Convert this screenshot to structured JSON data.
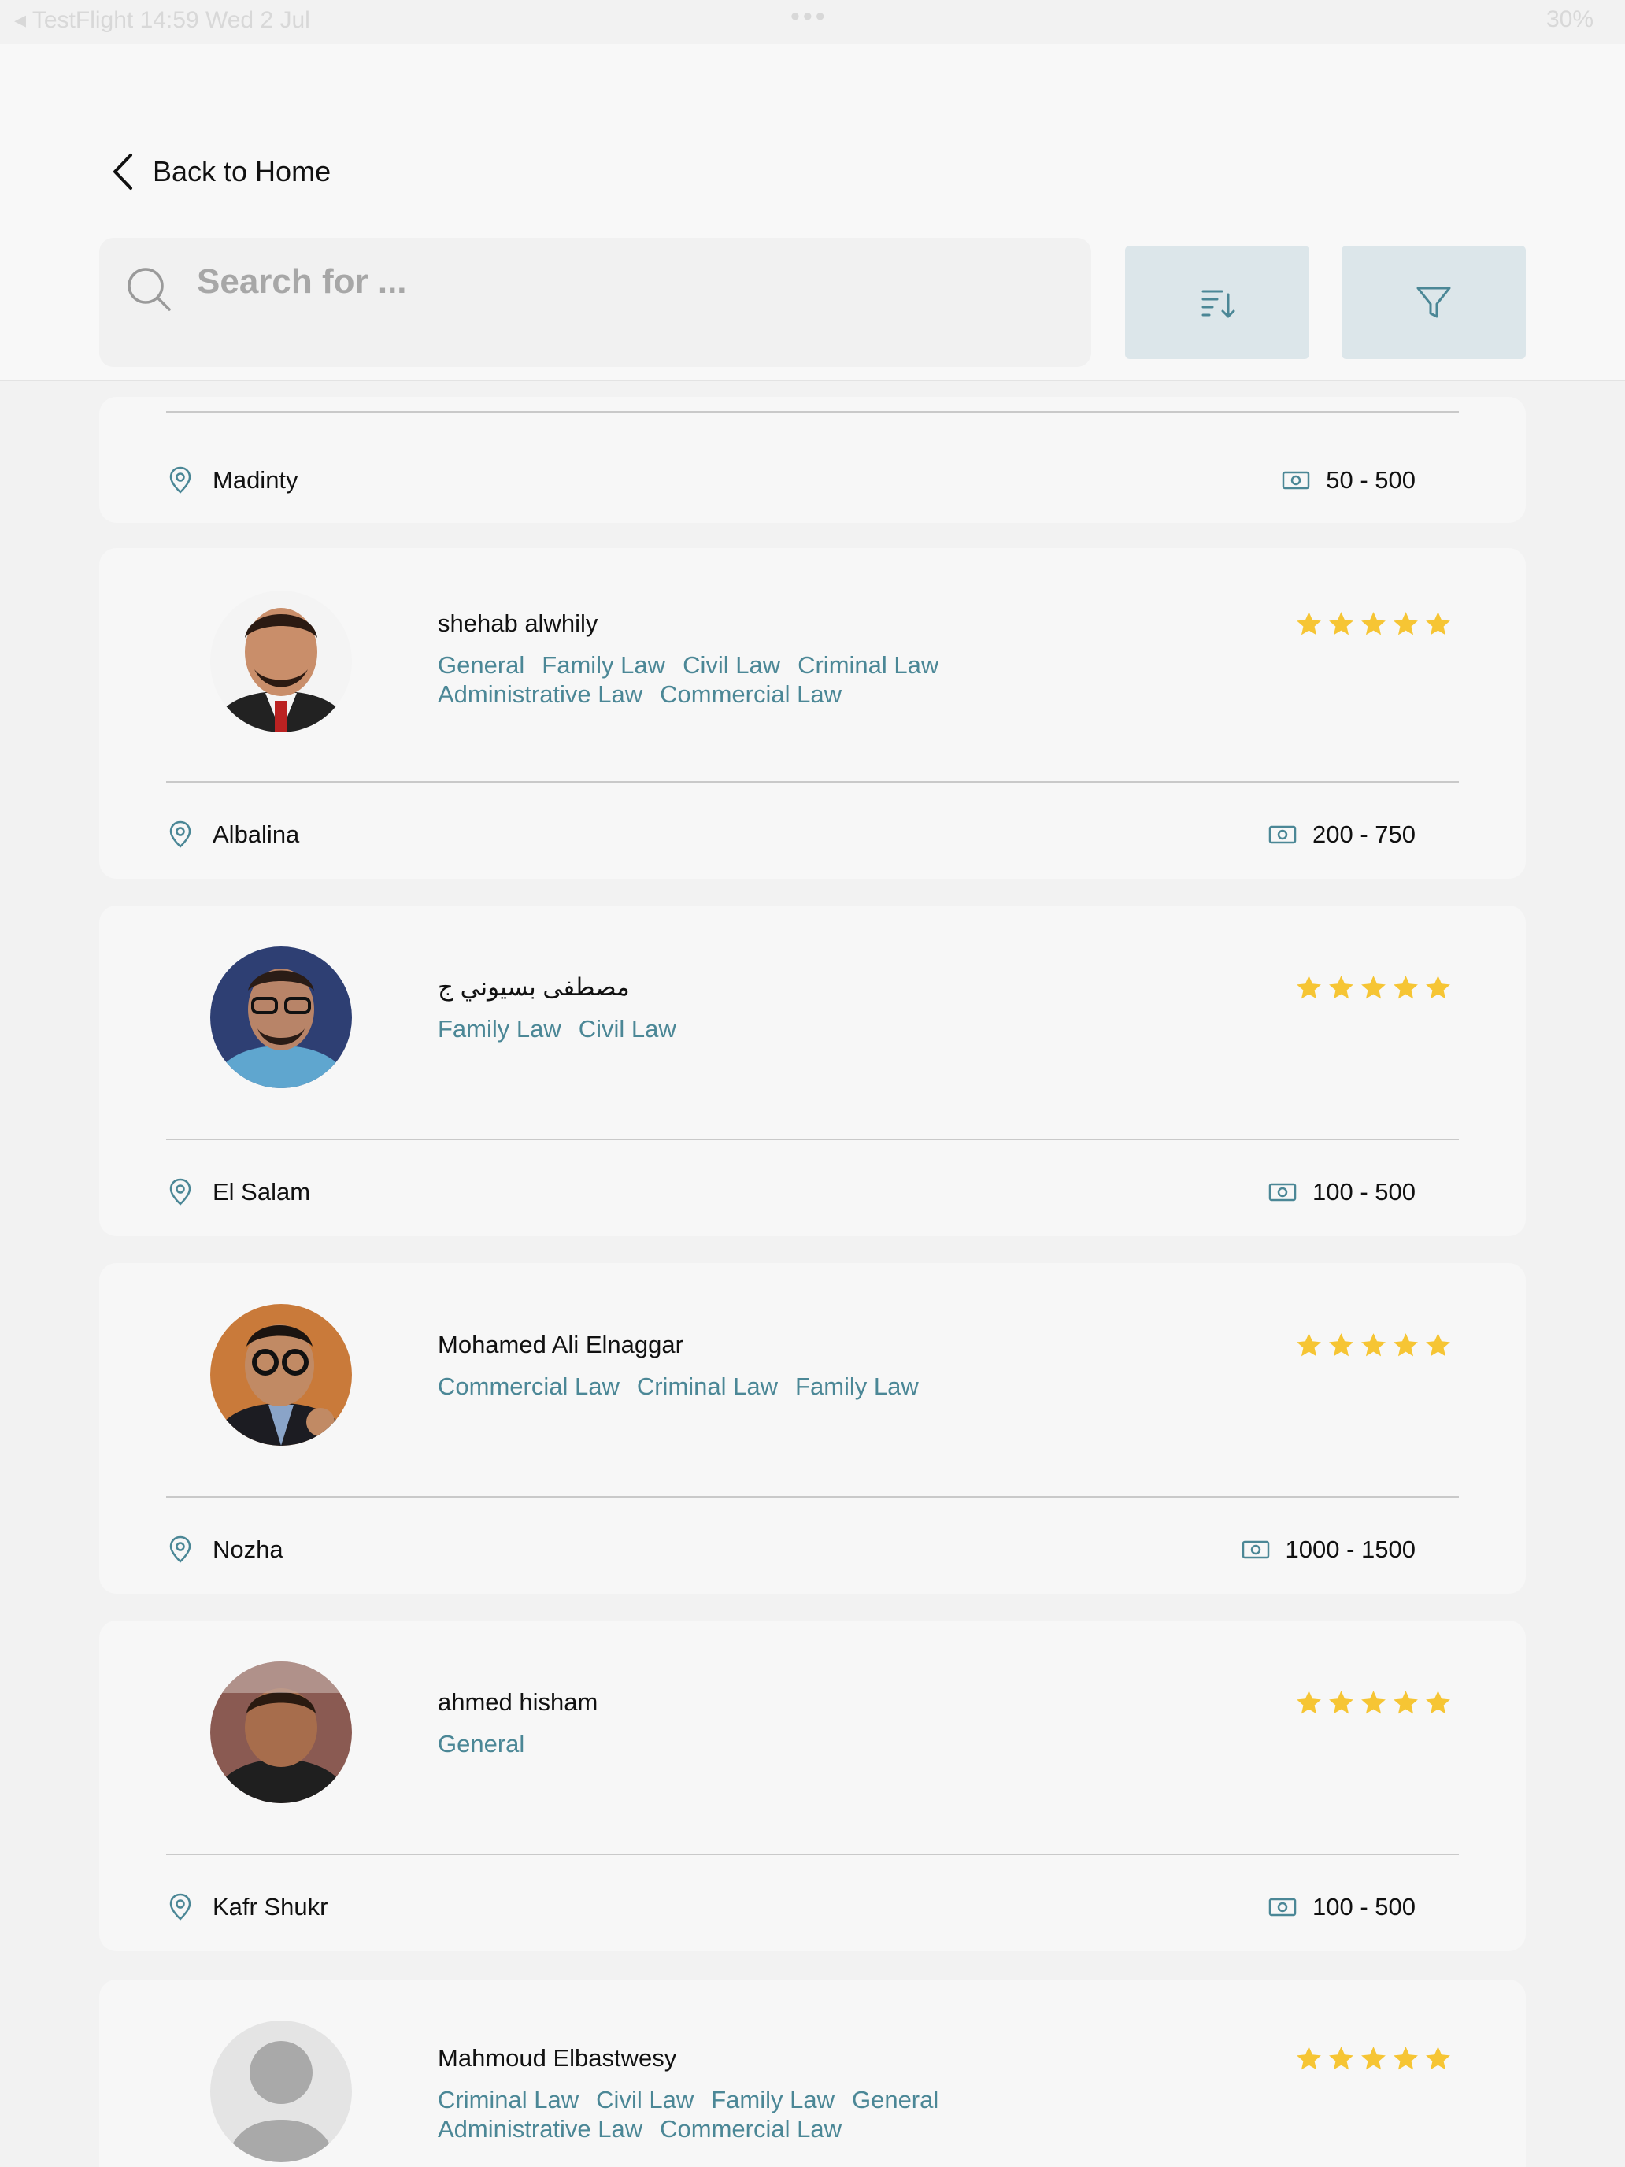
{
  "status_bar": {
    "left": "◂ TestFlight  14:59  Wed 2 Jul",
    "dots": "•••",
    "right": "30%"
  },
  "header": {
    "back_label": "Back to Home",
    "search_placeholder": "Search for ...",
    "sort_icon": "sort-icon",
    "filter_icon": "filter-icon"
  },
  "colors": {
    "accent": "#4b8796",
    "star": "#f6c534",
    "button_bg": "#dce6ea"
  },
  "partial_card": {
    "location": "Madinty",
    "fee": "50 - 500"
  },
  "lawyers": [
    {
      "name": "shehab  alwhily",
      "tags": [
        "General",
        "Family Law",
        "Civil Law",
        "Criminal Law",
        "Administrative Law",
        "Commercial Law"
      ],
      "rating": 5,
      "location": "Albalina",
      "fee": "200 - 750"
    },
    {
      "name": "مصطفى بسيوني ج",
      "tags": [
        "Family Law",
        "Civil Law"
      ],
      "rating": 5,
      "location": "El Salam",
      "fee": "100 - 500"
    },
    {
      "name": "Mohamed Ali Elnaggar",
      "tags": [
        "Commercial Law",
        "Criminal Law",
        "Family Law"
      ],
      "rating": 5,
      "location": "Nozha",
      "fee": "1000 - 1500"
    },
    {
      "name": "ahmed hisham",
      "tags": [
        "General"
      ],
      "rating": 5,
      "location": "Kafr Shukr",
      "fee": "100 - 500"
    },
    {
      "name": "Mahmoud Elbastwesy",
      "tags": [
        "Criminal Law",
        "Civil Law",
        "Family Law",
        "General",
        "Administrative Law",
        "Commercial Law"
      ],
      "rating": 5,
      "location": "",
      "fee": ""
    }
  ]
}
